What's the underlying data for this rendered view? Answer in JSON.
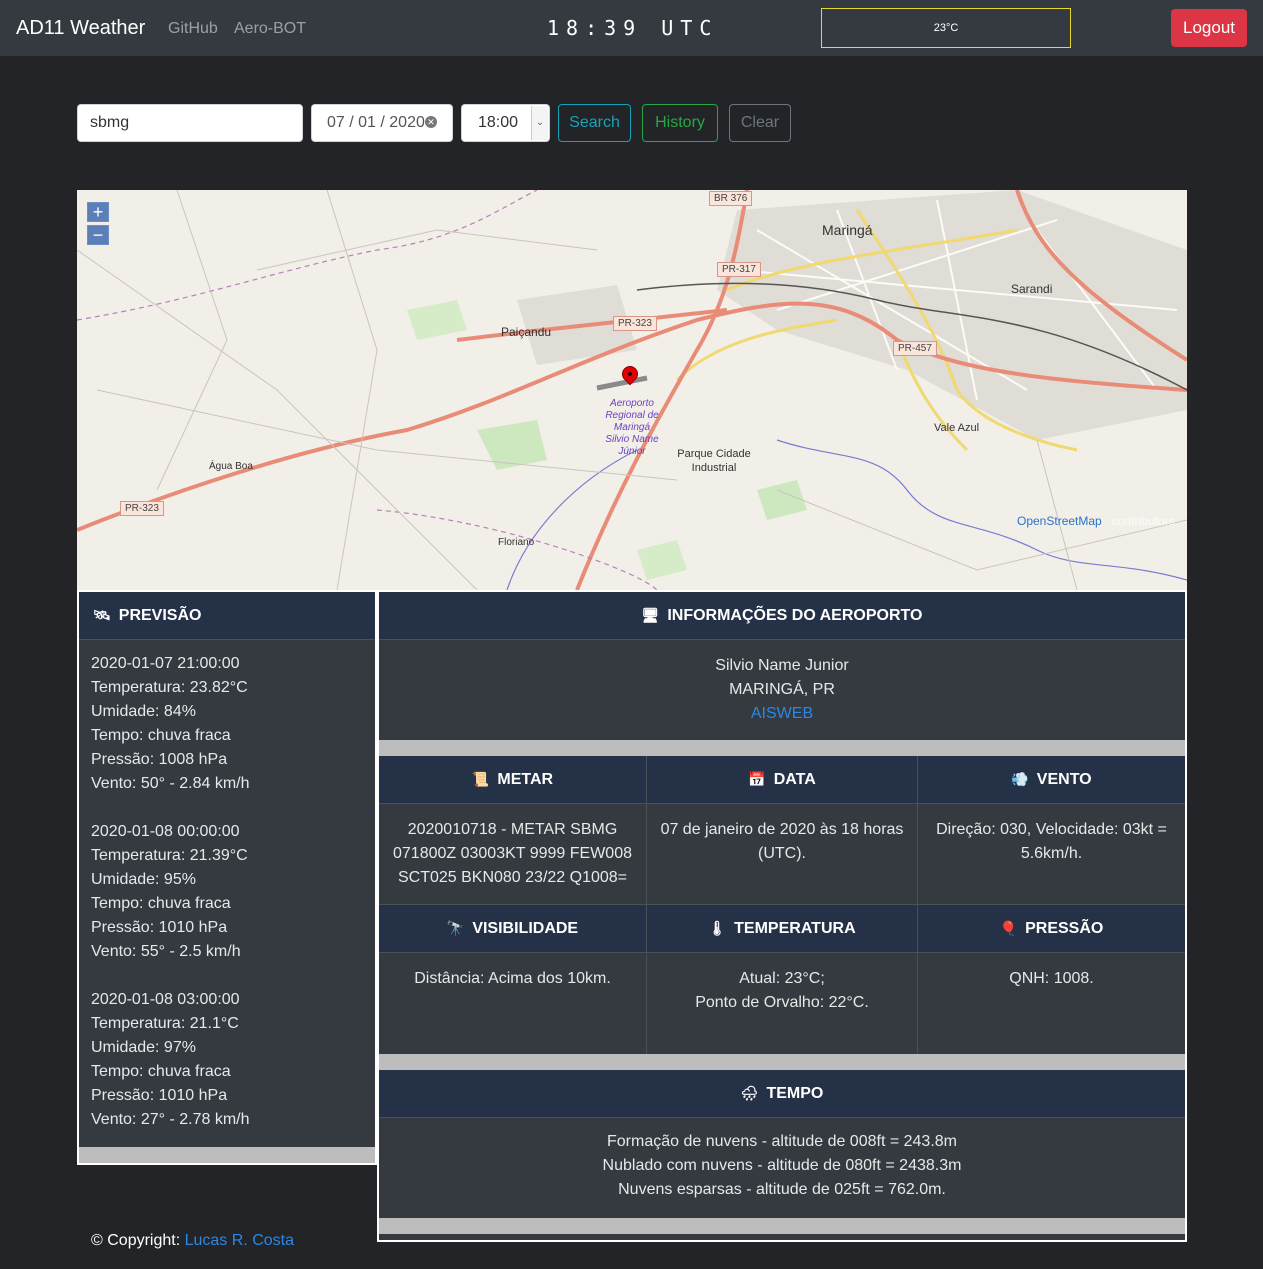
{
  "navbar": {
    "brand": "AD11 Weather",
    "links": [
      "GitHub",
      "Aero-BOT"
    ],
    "clock": "18:39 UTC",
    "temperature": "23°C",
    "logout_label": "Logout"
  },
  "search": {
    "airport_value": "sbmg",
    "date_value": "07 / 01 / 2020",
    "time_value": "18:00",
    "search_label": "Search",
    "history_label": "History",
    "clear_label": "Clear"
  },
  "map": {
    "zoom_in": "+",
    "zoom_out": "−",
    "places": [
      "Maringá",
      "Sarandi",
      "Paiçandu",
      "Vale Azul",
      "Parque Cidade Industrial",
      "Água Boa",
      "Floriano"
    ],
    "roads": [
      "BR 376",
      "PR-317",
      "PR-323",
      "PR-457",
      "PR-323"
    ],
    "airport_label": "Aeroporto Regional de Maringá Silvio Name Júnior",
    "attribution": "OpenStreetMap",
    "attribution_suffix": "contributors"
  },
  "forecast": {
    "title": "PREVISÃO",
    "icon": "satellite-icon",
    "entries": [
      {
        "datetime": "2020-01-07 21:00:00",
        "temp": "Temperatura: 23.82°C",
        "humidity": "Umidade: 84%",
        "weather": "Tempo: chuva fraca",
        "pressure": "Pressão: 1008 hPa",
        "wind": "Vento: 50° - 2.84 km/h"
      },
      {
        "datetime": "2020-01-08 00:00:00",
        "temp": "Temperatura: 21.39°C",
        "humidity": "Umidade: 95%",
        "weather": "Tempo: chuva fraca",
        "pressure": "Pressão: 1010 hPa",
        "wind": "Vento: 55° - 2.5 km/h"
      },
      {
        "datetime": "2020-01-08 03:00:00",
        "temp": "Temperatura: 21.1°C",
        "humidity": "Umidade: 97%",
        "weather": "Tempo: chuva fraca",
        "pressure": "Pressão: 1010 hPa",
        "wind": "Vento: 27° - 2.78 km/h"
      }
    ]
  },
  "airport": {
    "title": "INFORMAÇÕES DO AEROPORTO",
    "name": "Silvio Name Junior",
    "city": "MARINGÁ, PR",
    "link": "AISWEB"
  },
  "metar": {
    "title": "METAR",
    "lines": [
      "2020010718 - METAR SBMG",
      "071800Z 03003KT 9999 FEW008",
      "SCT025 BKN080 23/22 Q1008="
    ]
  },
  "data": {
    "title": "DATA",
    "lines": [
      "07 de janeiro de 2020 às 18 horas",
      "(UTC)."
    ]
  },
  "vento": {
    "title": "VENTO",
    "lines": [
      "Direção: 030, Velocidade: 03kt =",
      "5.6km/h."
    ]
  },
  "visibilidade": {
    "title": "VISIBILIDADE",
    "lines": [
      "Distância: Acima dos 10km."
    ]
  },
  "temperatura": {
    "title": "TEMPERATURA",
    "lines": [
      "Atual: 23°C;",
      "Ponto de Orvalho: 22°C."
    ]
  },
  "pressao": {
    "title": "PRESSÃO",
    "lines": [
      "QNH: 1008."
    ]
  },
  "tempo": {
    "title": "TEMPO",
    "lines": [
      "Formação de nuvens - altitude de 008ft = 243.8m",
      "Nublado com nuvens - altitude de 080ft = 2438.3m",
      "Nuvens esparsas - altitude de 025ft = 762.0m."
    ]
  },
  "footer": {
    "prefix": "© Copyright: ",
    "author": "Lucas R. Costa"
  }
}
